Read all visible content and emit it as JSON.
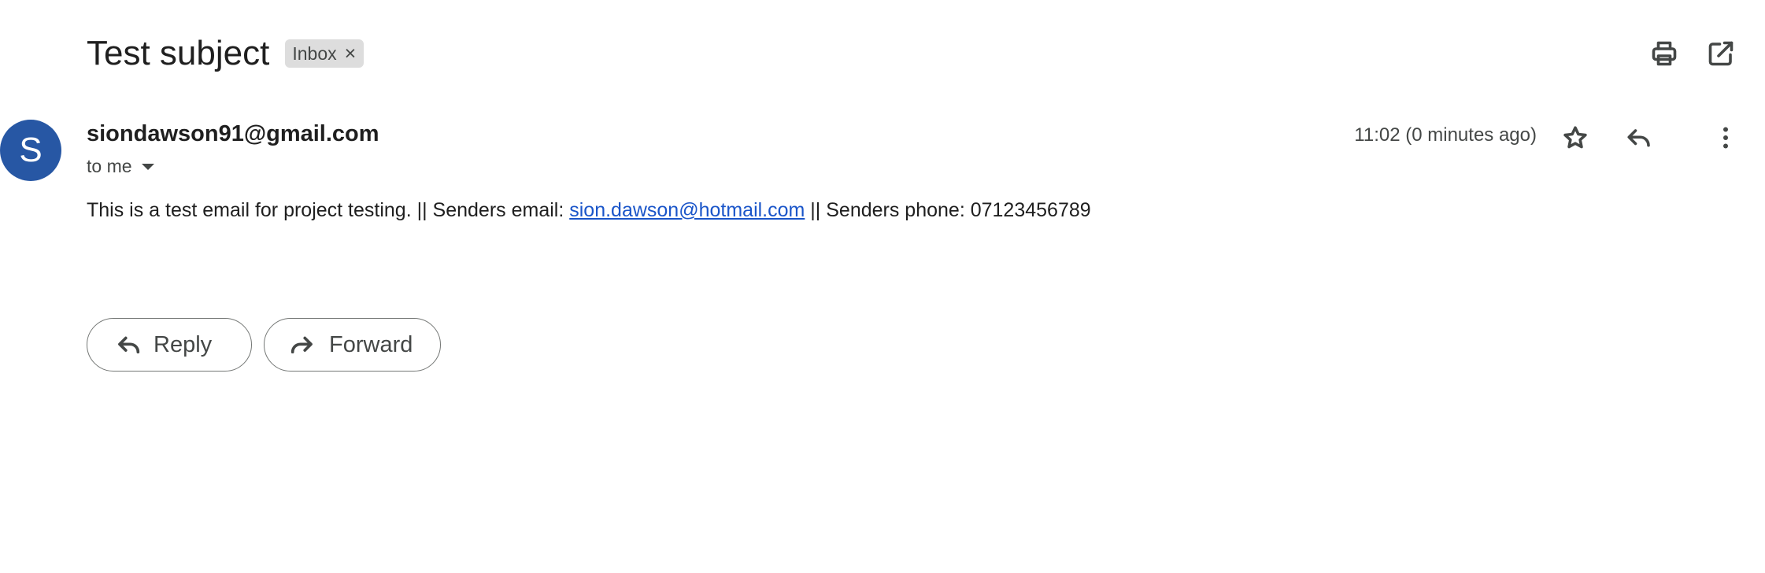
{
  "email": {
    "subject": "Test subject",
    "label": "Inbox",
    "label_remove_glyph": "×",
    "sender": "siondawson91@gmail.com",
    "avatar_letter": "S",
    "recipient": "to me",
    "timestamp": "11:02 (0 minutes ago)",
    "body": {
      "text_before_link": "This is a test email for project testing. || Senders email: ",
      "link_text": "sion.dawson@hotmail.com",
      "text_after_link": " || Senders phone: 07123456789"
    }
  },
  "actions": {
    "reply_label": "Reply",
    "forward_label": "Forward"
  },
  "icons": {
    "toolbar": [
      "print-icon",
      "open-in-new-window-icon"
    ],
    "message": [
      "star-icon",
      "reply-icon",
      "more-vert-icon"
    ]
  },
  "colors": {
    "avatar": "#2757a4",
    "link": "#1a55c9",
    "chip_background": "#dddddd"
  }
}
